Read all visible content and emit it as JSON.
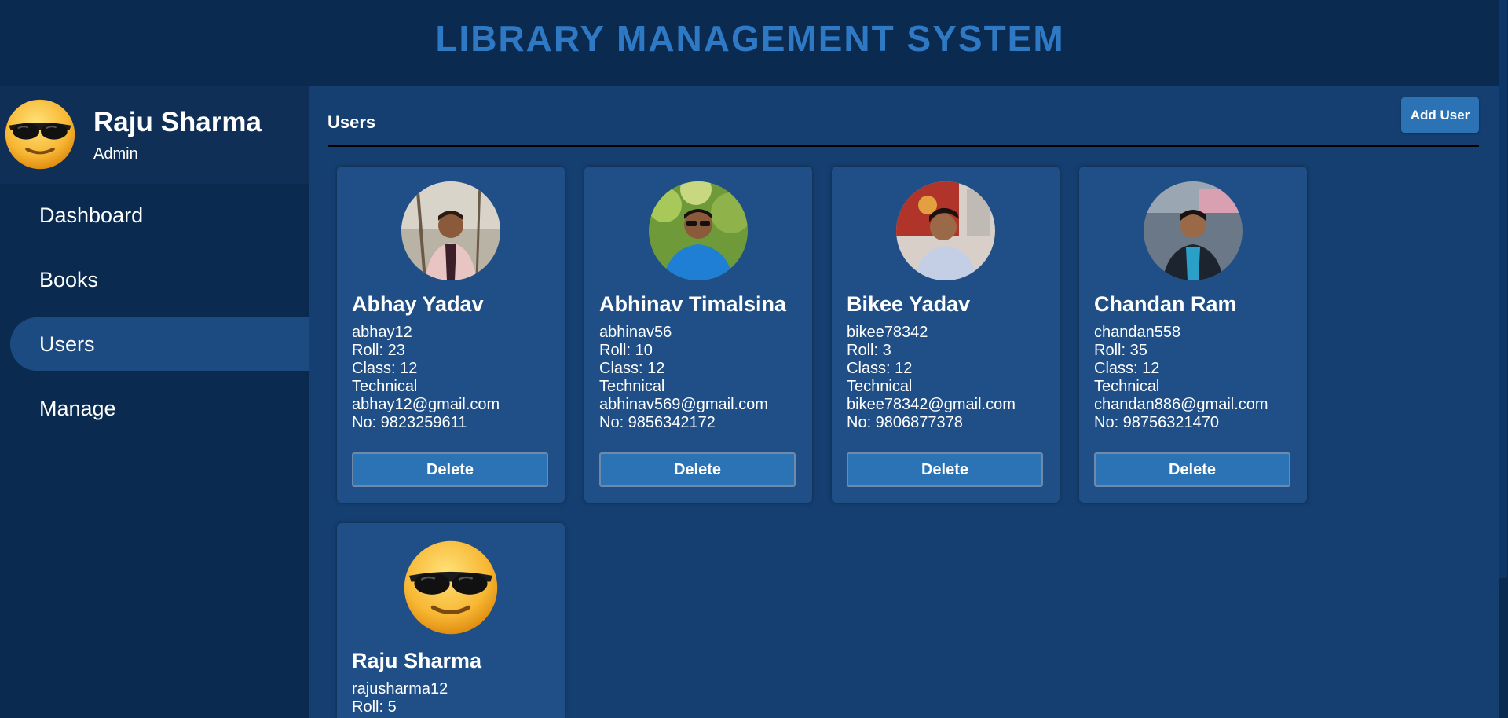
{
  "app_title": "LIBRARY MANAGEMENT SYSTEM",
  "profile": {
    "name": "Raju Sharma",
    "role": "Admin",
    "avatar_icon": "sunglasses-emoji-icon"
  },
  "nav": [
    {
      "label": "Dashboard",
      "active": false
    },
    {
      "label": "Books",
      "active": false
    },
    {
      "label": "Users",
      "active": true
    },
    {
      "label": "Manage",
      "active": false
    }
  ],
  "main": {
    "title": "Users",
    "add_button": "Add User"
  },
  "users": [
    {
      "name": "Abhay Yadav",
      "username": "abhay12",
      "roll": "Roll: 23",
      "class": "Class: 12",
      "stream": "Technical",
      "email": "abhay12@gmail.com",
      "phone": "No: 9823259611",
      "delete_label": "Delete"
    },
    {
      "name": "Abhinav Timalsina",
      "username": "abhinav56",
      "roll": "Roll: 10",
      "class": "Class: 12",
      "stream": "Technical",
      "email": "abhinav569@gmail.com",
      "phone": "No: 9856342172",
      "delete_label": "Delete"
    },
    {
      "name": "Bikee Yadav",
      "username": "bikee78342",
      "roll": "Roll: 3",
      "class": "Class: 12",
      "stream": "Technical",
      "email": "bikee78342@gmail.com",
      "phone": "No: 9806877378",
      "delete_label": "Delete"
    },
    {
      "name": "Chandan Ram",
      "username": "chandan558",
      "roll": "Roll: 35",
      "class": "Class: 12",
      "stream": "Technical",
      "email": "chandan886@gmail.com",
      "phone": "No: 98756321470",
      "delete_label": "Delete"
    },
    {
      "name": "Raju Sharma",
      "username": "rajusharma12",
      "roll": "Roll: 5"
    }
  ],
  "colors": {
    "header_bg": "#0a2a4f",
    "main_bg": "#153f70",
    "card_bg": "#1f4f86",
    "accent": "#2f79c4",
    "button": "#2c73b5"
  }
}
